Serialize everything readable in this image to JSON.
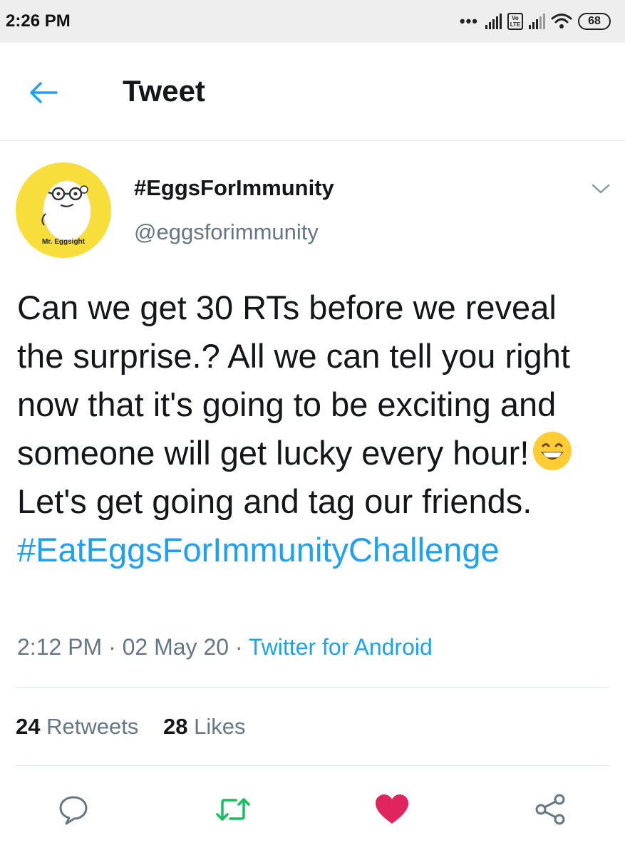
{
  "status_bar": {
    "time": "2:26 PM",
    "battery": "68",
    "volte_top": "Vo",
    "volte_bottom": "LTE"
  },
  "header": {
    "title": "Tweet",
    "back_icon": "arrow-left-icon"
  },
  "author": {
    "display_name": "#EggsForImmunity",
    "handle": "@eggsforimmunity",
    "avatar_caption": "Mr. Eggsight"
  },
  "tweet": {
    "text_part1": "Can we get 30 RTs before we reveal the surprise.? All we can tell you right now that it's going to be exciting and someone will get lucky every hour!",
    "text_part2": "Let's get going and tag our friends.",
    "hashtag": "#EatEggsForImmunityChallenge",
    "emoji": "grinning-face-icon"
  },
  "meta": {
    "time": "2:12 PM",
    "separator": " · ",
    "date": "02 May 20",
    "source": "Twitter for Android"
  },
  "stats": {
    "retweets_count": "24",
    "retweets_label": "Retweets",
    "likes_count": "28",
    "likes_label": "Likes"
  },
  "colors": {
    "accent": "#1da1f2",
    "retweet_active": "#17bf63",
    "like_active": "#e0245e",
    "avatar_bg": "#f7de3a"
  }
}
